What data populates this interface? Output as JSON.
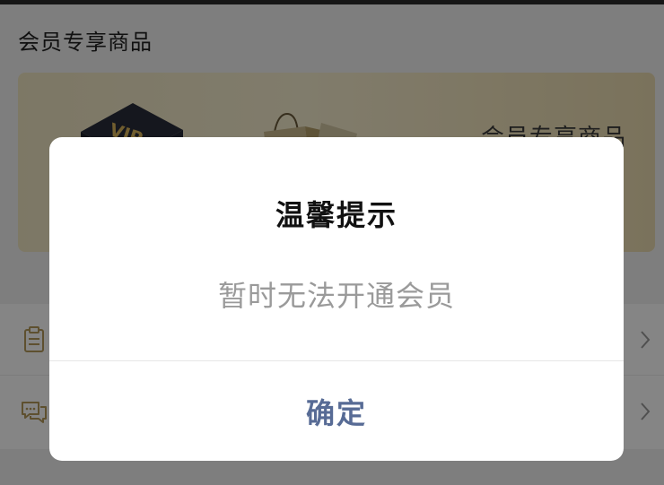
{
  "page": {
    "section_title": "会员专享商品"
  },
  "banner": {
    "label": "会员专享商品",
    "vip_text": "VIP",
    "vip_icon": "vip-box-icon",
    "bag_icon": "shopping-bag-icon"
  },
  "list": {
    "items": [
      {
        "icon": "clipboard-icon"
      },
      {
        "icon": "chat-icon"
      }
    ],
    "chevron_icon": "chevron-right-icon"
  },
  "dialog": {
    "title": "温馨提示",
    "message": "暂时无法开通会员",
    "confirm_label": "确定"
  },
  "colors": {
    "accent": "#576b95",
    "banner_gold": "#efe6c2",
    "mask": "#000000"
  }
}
